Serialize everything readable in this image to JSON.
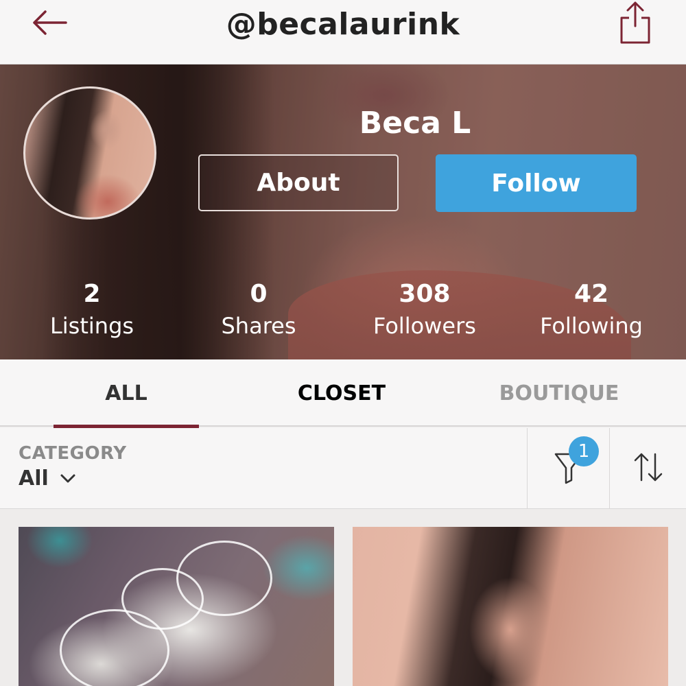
{
  "header": {
    "username": "@becalaurink"
  },
  "profile": {
    "display_name": "Beca L",
    "about_label": "About",
    "follow_label": "Follow",
    "stats": [
      {
        "value": "2",
        "label": "Listings"
      },
      {
        "value": "0",
        "label": "Shares"
      },
      {
        "value": "308",
        "label": "Followers"
      },
      {
        "value": "42",
        "label": "Following"
      }
    ]
  },
  "tabs": [
    {
      "label": "ALL",
      "active": true
    },
    {
      "label": "CLOSET",
      "active": false
    },
    {
      "label": "BOUTIQUE",
      "active": false
    }
  ],
  "filter": {
    "category_label": "CATEGORY",
    "category_value": "All",
    "filter_badge": "1"
  },
  "colors": {
    "accent_burgundy": "#7c2433",
    "follow_blue": "#3fa3dd"
  },
  "icons": {
    "back": "arrow-left-icon",
    "share": "share-icon",
    "filter": "filter-funnel-icon",
    "sort": "sort-arrows-icon",
    "dropdown": "chevron-down-icon"
  }
}
